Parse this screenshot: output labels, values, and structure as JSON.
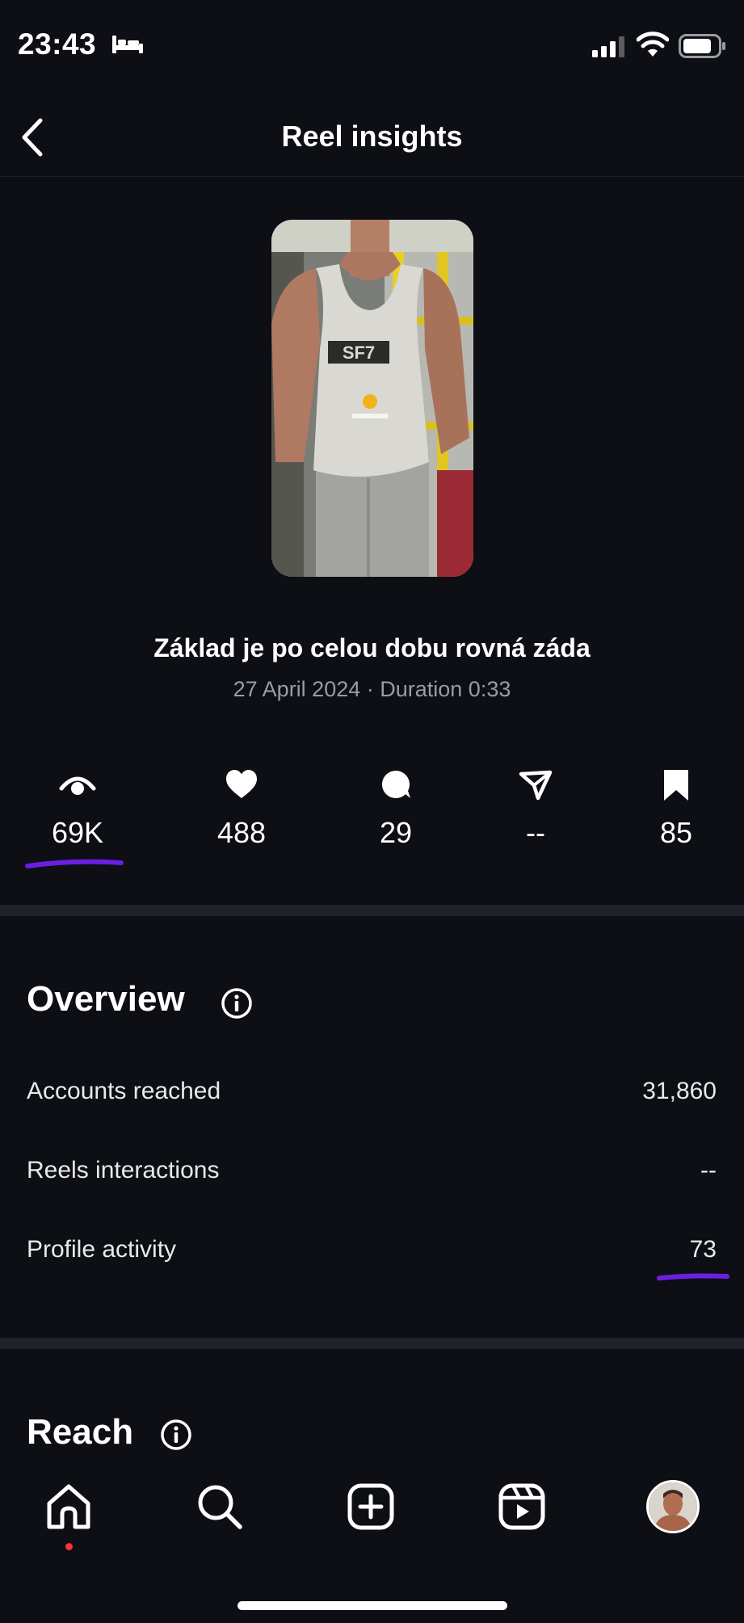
{
  "status_bar": {
    "time": "23:43",
    "icons": [
      "bed-icon",
      "signal-icon",
      "wifi-icon",
      "battery-icon"
    ]
  },
  "header": {
    "title": "Reel insights",
    "back_icon": "chevron-left-icon"
  },
  "reel": {
    "caption": "Základ je po celou dobu rovná záda",
    "meta": "27 April 2024 · Duration 0:33",
    "thumbnail_shirt_text": "SF7"
  },
  "metrics": [
    {
      "icon": "eye-icon",
      "value": "69K"
    },
    {
      "icon": "heart-icon",
      "value": "488"
    },
    {
      "icon": "comment-icon",
      "value": "29"
    },
    {
      "icon": "share-icon",
      "value": "--"
    },
    {
      "icon": "bookmark-icon",
      "value": "85"
    }
  ],
  "overview": {
    "title": "Overview",
    "rows": [
      {
        "label": "Accounts reached",
        "value": "31,860"
      },
      {
        "label": "Reels interactions",
        "value": "--"
      },
      {
        "label": "Profile activity",
        "value": "73"
      }
    ]
  },
  "reach": {
    "title": "Reach"
  },
  "bottom_nav": {
    "items": [
      "home-icon",
      "search-icon",
      "create-icon",
      "reels-icon",
      "profile-avatar"
    ]
  },
  "colors": {
    "background": "#0d0f14",
    "divider": "#1f2228",
    "highlight": "#6b1fe0",
    "notification_dot": "#ff3040",
    "muted_text": "#9a9ca3"
  }
}
